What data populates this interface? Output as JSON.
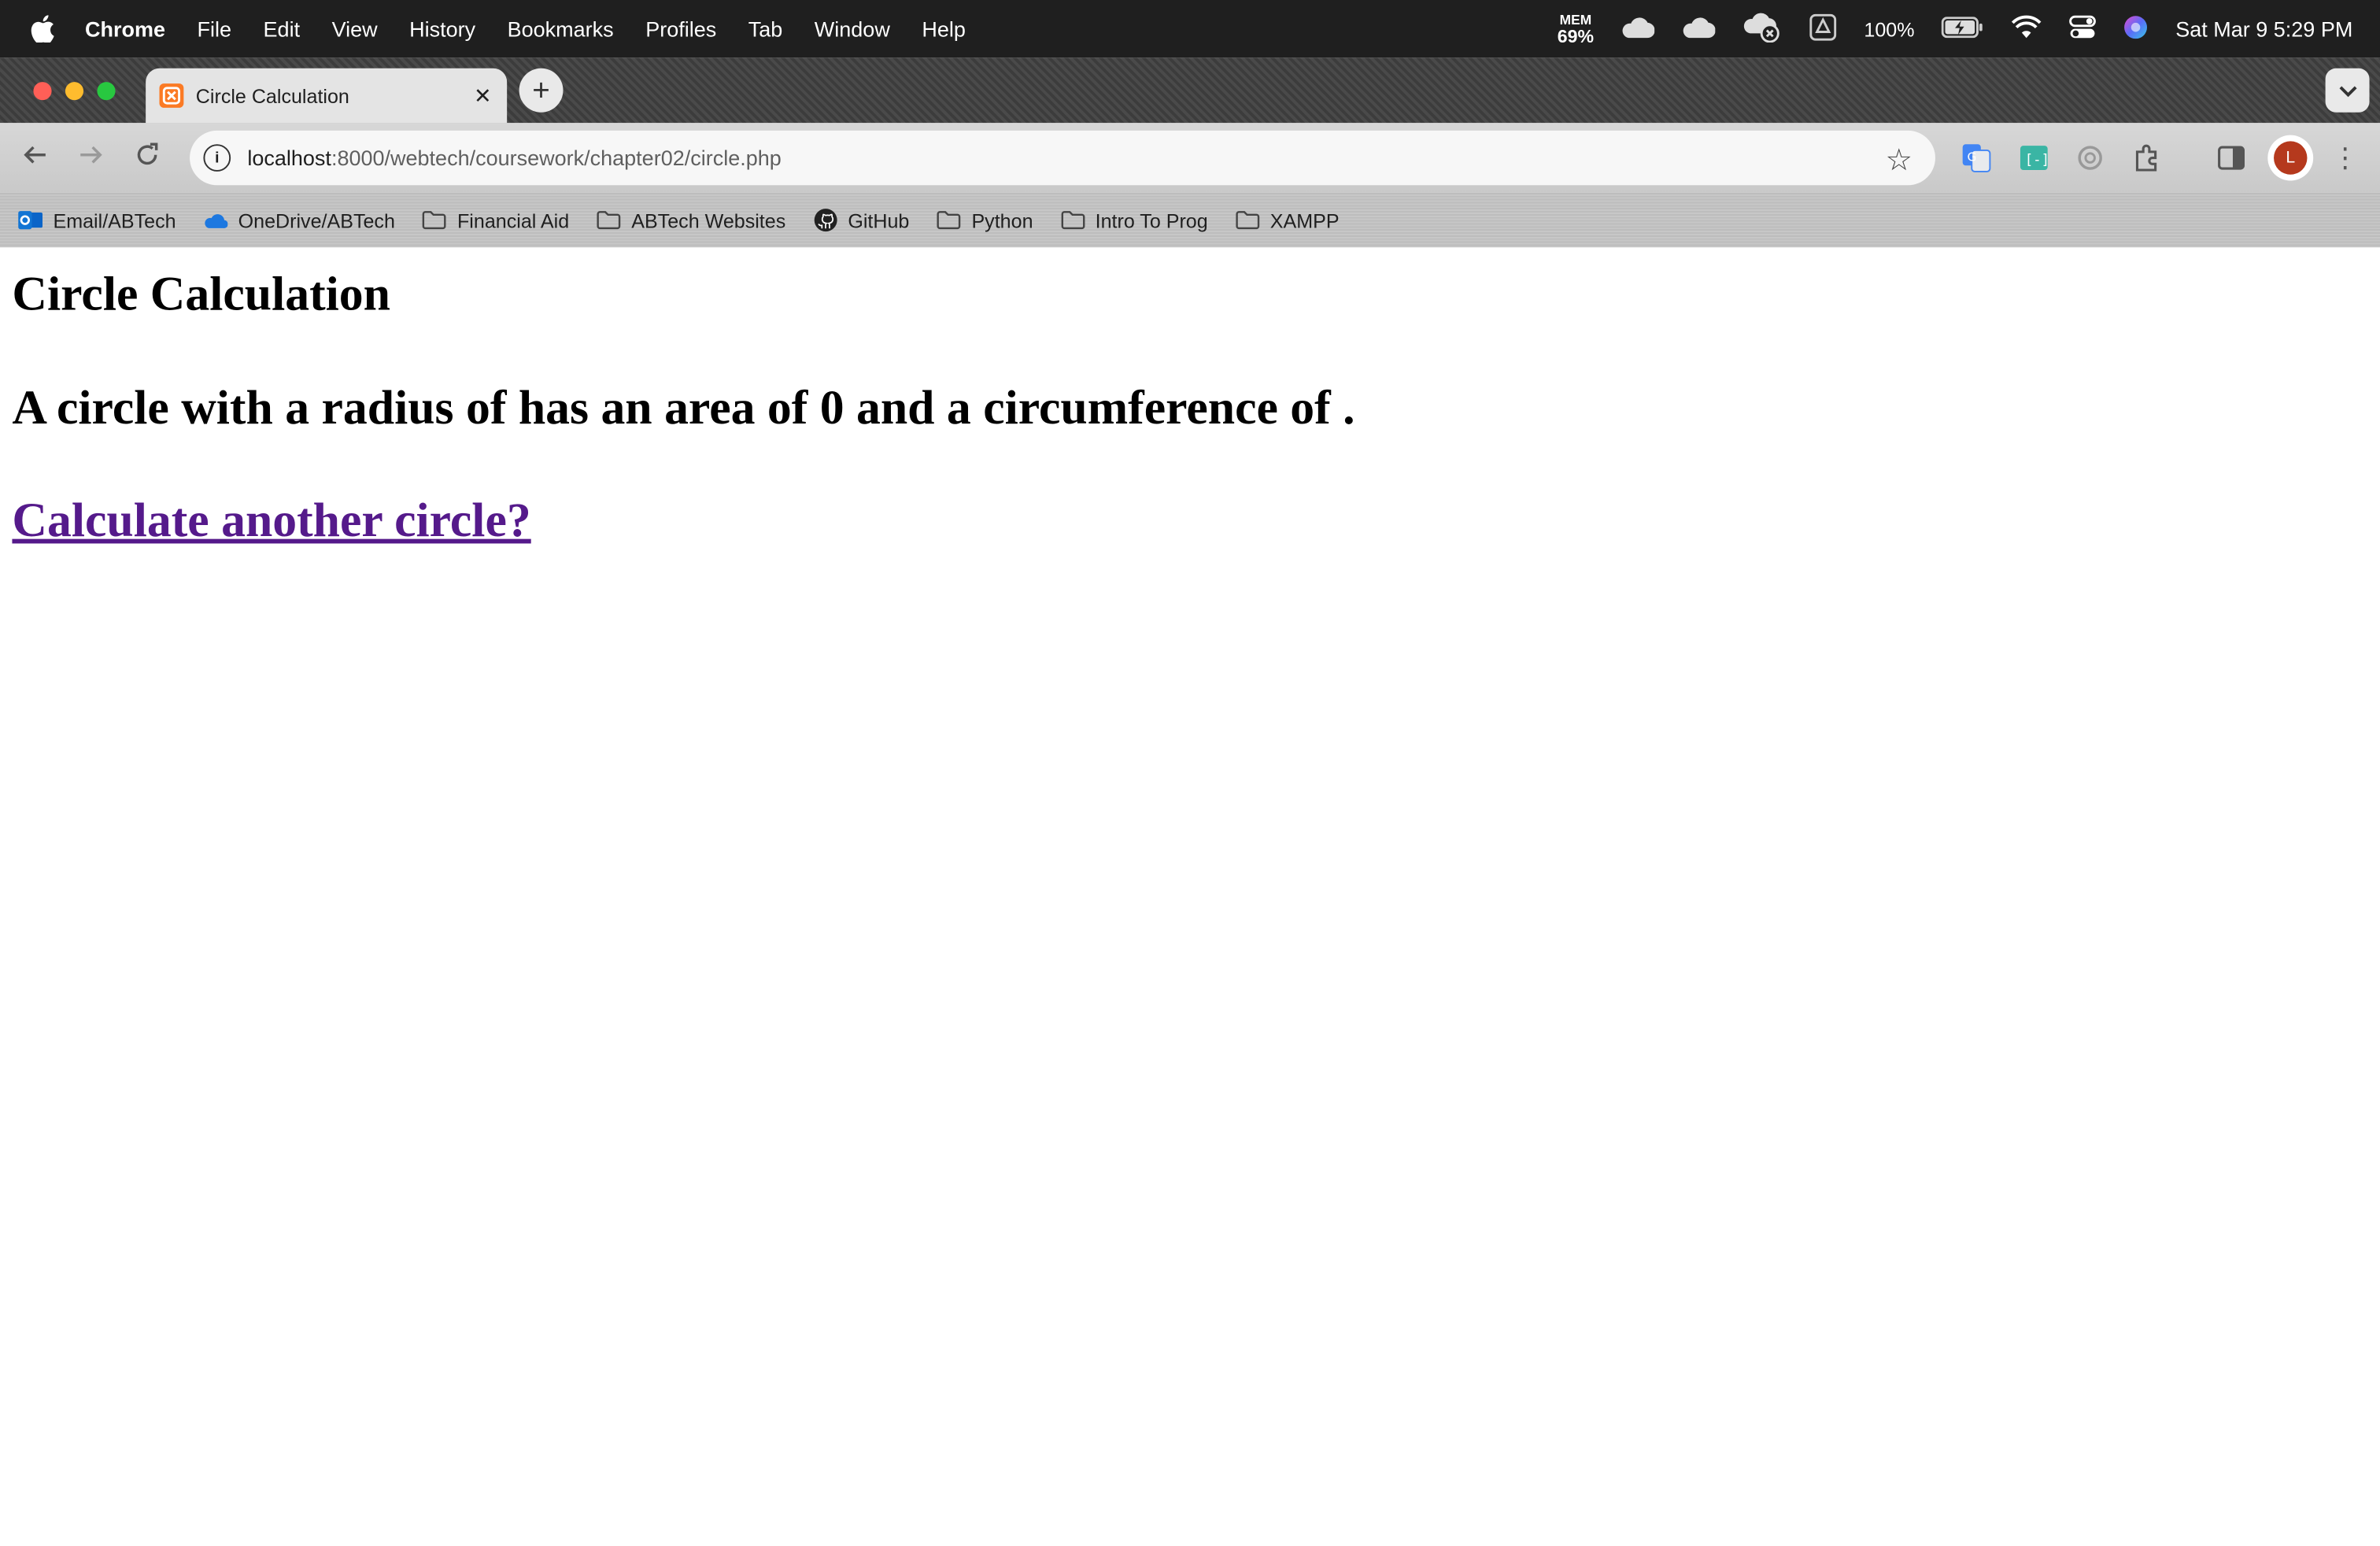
{
  "menubar": {
    "app_name": "Chrome",
    "menu_items": [
      "File",
      "Edit",
      "View",
      "History",
      "Bookmarks",
      "Profiles",
      "Tab",
      "Window",
      "Help"
    ],
    "mem_label": "MEM",
    "mem_value": "69%",
    "battery_pct": "100%",
    "datetime": "Sat Mar 9  5:29 PM"
  },
  "browser": {
    "tab_title": "Circle Calculation",
    "url_host": "localhost",
    "url_rest": ":8000/webtech/coursework/chapter02/circle.php",
    "avatar_initial": "L"
  },
  "bookmarks": [
    {
      "label": "Email/ABTech",
      "icon": "outlook-icon"
    },
    {
      "label": "OneDrive/ABTech",
      "icon": "onedrive-icon"
    },
    {
      "label": "Financial Aid",
      "icon": "folder-icon"
    },
    {
      "label": "ABTech Websites",
      "icon": "folder-icon"
    },
    {
      "label": "GitHub",
      "icon": "github-icon"
    },
    {
      "label": "Python",
      "icon": "folder-icon"
    },
    {
      "label": "Intro To Prog",
      "icon": "folder-icon"
    },
    {
      "label": "XAMPP",
      "icon": "folder-icon"
    }
  ],
  "page": {
    "heading": "Circle Calculation",
    "result": "A circle with a radius of has an area of 0 and a circumference of .",
    "link": "Calculate another circle?"
  },
  "colors": {
    "visited_link": "#551a8b",
    "menubar_bg": "#1f1f1f",
    "avatar_bg": "#b5391d"
  }
}
